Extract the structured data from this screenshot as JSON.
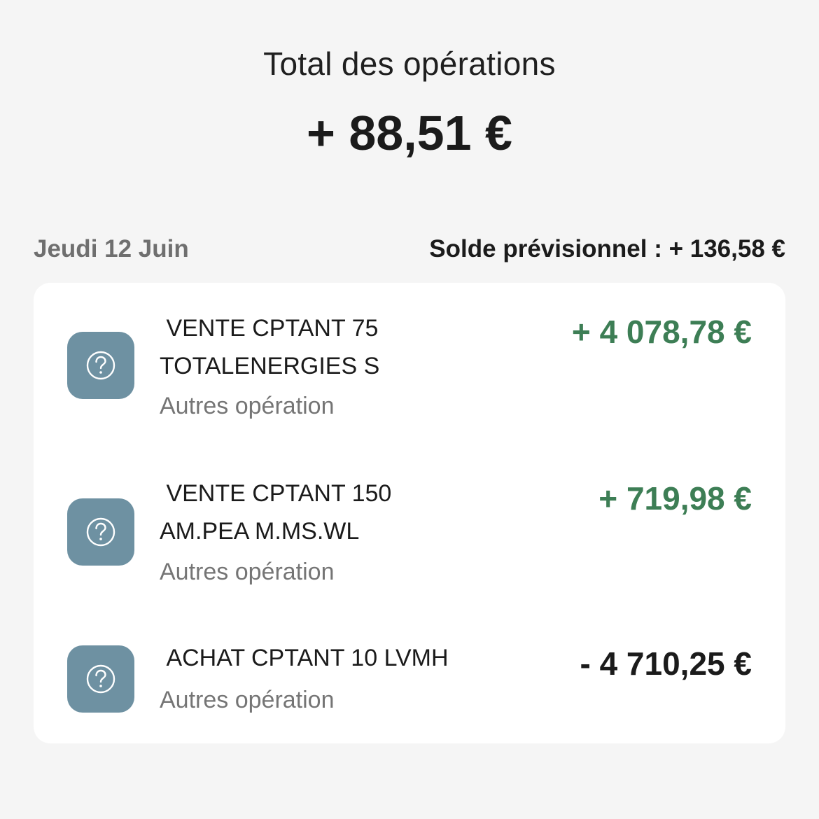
{
  "summary": {
    "label": "Total des opérations",
    "value": "+ 88,51 €"
  },
  "day": {
    "label": "Jeudi 12 Juin",
    "balance": "Solde prévisionnel : + 136,58 €"
  },
  "operations": [
    {
      "title": " VENTE CPTANT 75\nTOTALENERGIES S",
      "category": "Autres opération",
      "amount": "+ 4 078,78 €",
      "icon": "question-mark-icon"
    },
    {
      "title": " VENTE CPTANT 150\nAM.PEA M.MS.WL",
      "category": "Autres opération",
      "amount": "+ 719,98 €",
      "icon": "question-mark-icon"
    },
    {
      "title": " ACHAT CPTANT 10 LVMH",
      "category": "Autres opération",
      "amount": "- 4 710,25 €",
      "icon": "question-mark-icon"
    }
  ],
  "colors": {
    "positive": "#3d7e55",
    "negative": "#1b1b1b",
    "icon_bg": "#6e91a2",
    "background": "#f5f5f5"
  }
}
